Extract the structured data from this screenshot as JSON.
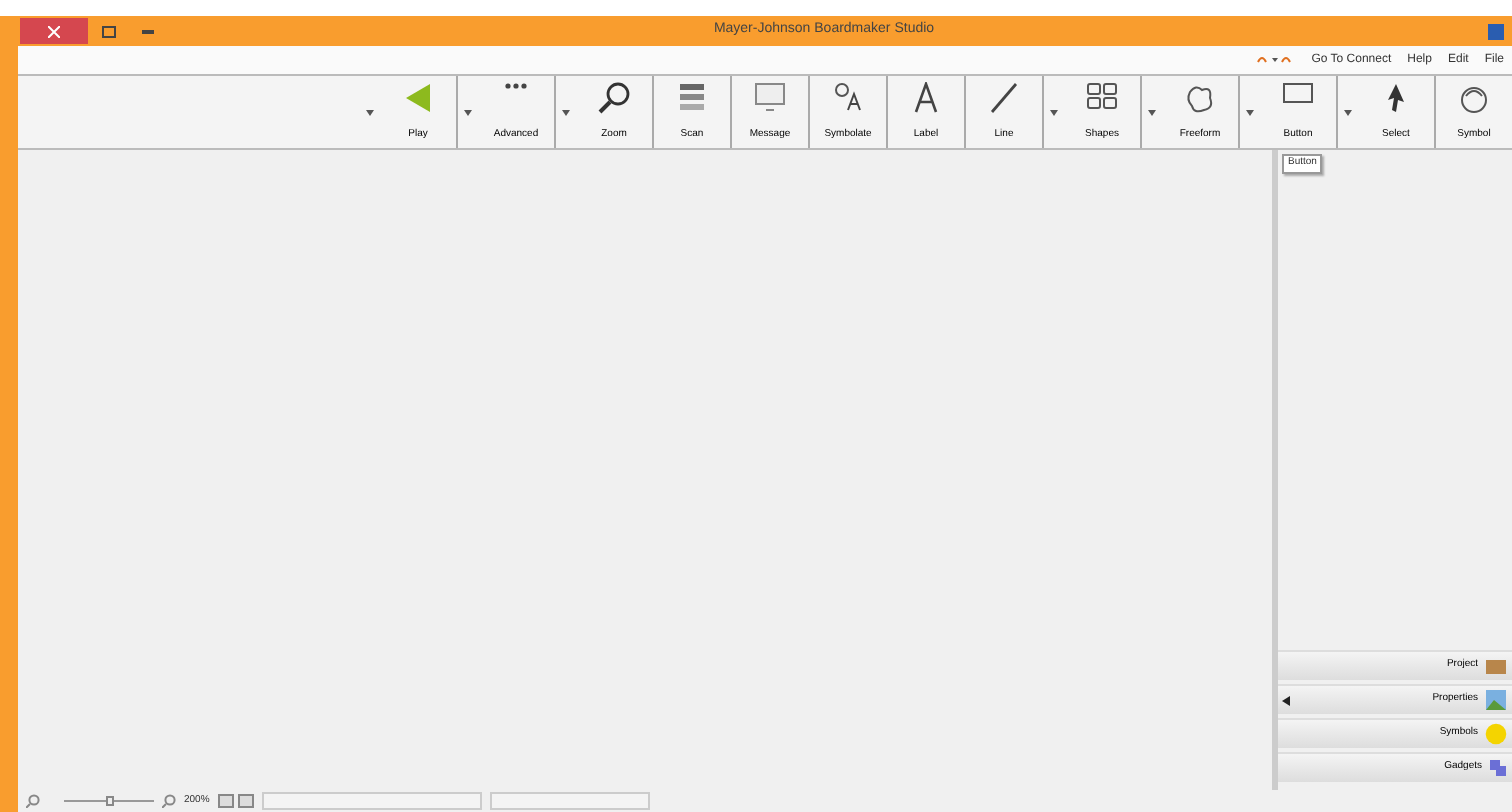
{
  "window": {
    "title": "Mayer-Johnson Boardmaker Studio"
  },
  "menu": [
    {
      "label": "Go To Connect"
    },
    {
      "label": "Help"
    },
    {
      "label": "Edit"
    },
    {
      "label": "File"
    }
  ],
  "toolbar": [
    {
      "label": "Play",
      "kind": "triangle",
      "dropdown": true
    },
    {
      "label": "Advanced",
      "kind": "dots",
      "dropdown": true
    },
    {
      "label": "Zoom",
      "kind": "magnifier",
      "dropdown": true
    },
    {
      "label": "Scan",
      "kind": "stack",
      "dropdown": false
    },
    {
      "label": "Message",
      "kind": "screen",
      "dropdown": false
    },
    {
      "label": "Symbolate",
      "kind": "symbolate",
      "dropdown": false
    },
    {
      "label": "Label",
      "kind": "letter",
      "dropdown": false
    },
    {
      "label": "Line",
      "kind": "line",
      "dropdown": false
    },
    {
      "label": "Shapes",
      "kind": "shapes",
      "dropdown": true
    },
    {
      "label": "Freeform",
      "kind": "blob",
      "dropdown": true
    },
    {
      "label": "Button",
      "kind": "rect",
      "dropdown": true
    },
    {
      "label": "Select",
      "kind": "pointer",
      "dropdown": true
    },
    {
      "label": "Symbol",
      "kind": "face",
      "dropdown": false
    }
  ],
  "tooltip": "Button",
  "panels": [
    {
      "label": "Project",
      "kind": "box",
      "expanded": false
    },
    {
      "label": "Properties",
      "kind": "picture",
      "expanded": true
    },
    {
      "label": "Symbols",
      "kind": "smiley",
      "expanded": false
    },
    {
      "label": "Gadgets",
      "kind": "puzzle",
      "expanded": false
    }
  ],
  "status_bar": {
    "zoom": "200%",
    "zoom_slider": {
      "level": 0.5
    }
  }
}
